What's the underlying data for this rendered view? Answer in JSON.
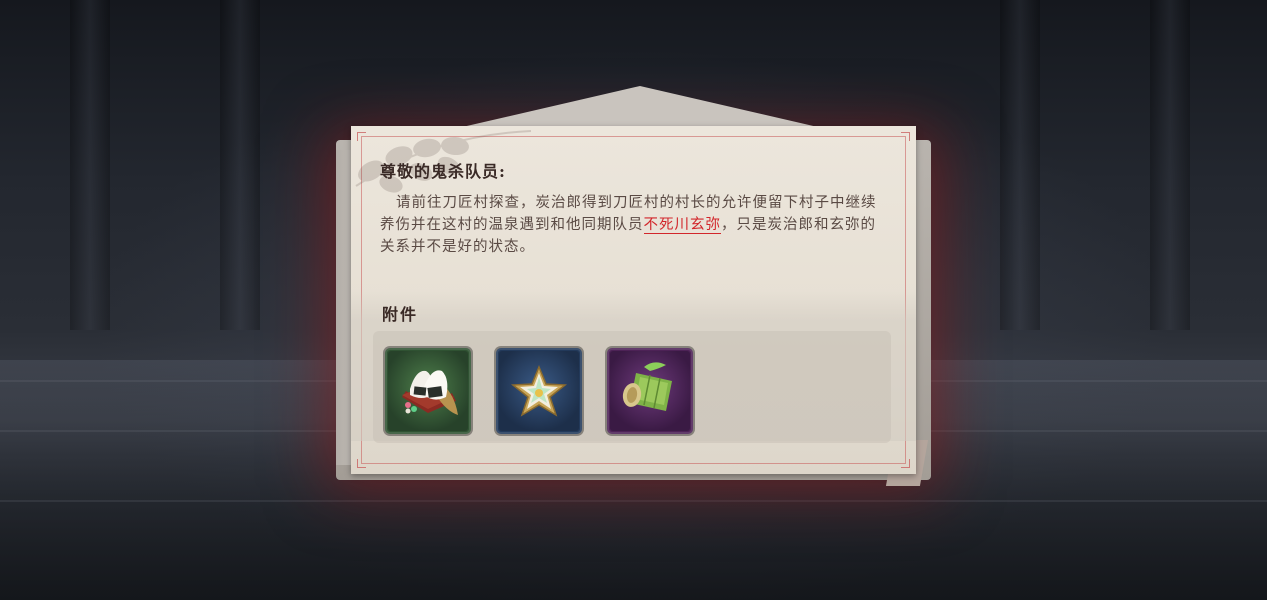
{
  "letter": {
    "greeting": "尊敬的鬼杀队员:",
    "body_before": "请前往刀匠村探查，炭治郎得到刀匠村的村长的允许便留下村子中继续养伤并在这村的温泉遇到和他同期队员",
    "highlight_name": "不死川玄弥",
    "body_after": "，只是炭治郎和玄弥的关系并不是好的状态。"
  },
  "attachments": {
    "title": "附件",
    "items": [
      {
        "name": "rice-ball",
        "icon": "onigiri-icon",
        "rarity_color": "#3e6a3e"
      },
      {
        "name": "star-flower",
        "icon": "star-flower-icon",
        "rarity_color": "#2d4e75"
      },
      {
        "name": "bamboo-tube",
        "icon": "bamboo-icon",
        "rarity_color": "#6a2c76"
      }
    ]
  },
  "colors": {
    "highlight": "#d2262b",
    "glow": "#961414"
  }
}
